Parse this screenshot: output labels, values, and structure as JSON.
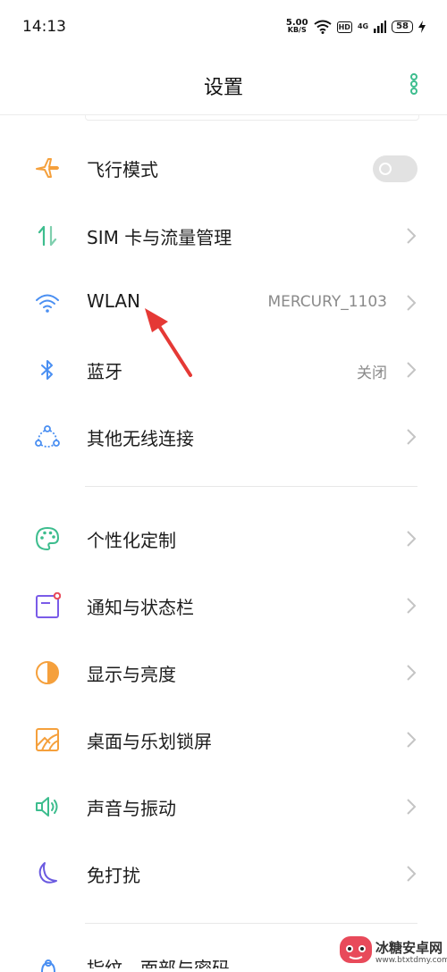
{
  "status_bar": {
    "time": "14:13",
    "net_speed_value": "5.00",
    "net_speed_unit": "KB/S",
    "hd_label": "HD",
    "network_type": "4G",
    "battery": "58"
  },
  "header": {
    "title": "设置"
  },
  "wireless_section": [
    {
      "id": "airplane",
      "label": "飞行模式",
      "toggle_on": false,
      "icon": "airplane-icon",
      "color": "#f5a03c"
    },
    {
      "id": "sim",
      "label": "SIM 卡与流量管理",
      "icon": "sim-data-icon",
      "color": "#3dbd8e"
    },
    {
      "id": "wlan",
      "label": "WLAN",
      "value": "MERCURY_1103",
      "icon": "wifi-icon",
      "color": "#4a8ff2"
    },
    {
      "id": "bluetooth",
      "label": "蓝牙",
      "value": "关闭",
      "icon": "bluetooth-icon",
      "color": "#4a8ff2"
    },
    {
      "id": "other",
      "label": "其他无线连接",
      "icon": "wireless-connections-icon",
      "color": "#4a8ff2"
    }
  ],
  "personal_section": [
    {
      "id": "personalize",
      "label": "个性化定制",
      "icon": "palette-icon",
      "color": "#3dbd8e"
    },
    {
      "id": "notify",
      "label": "通知与状态栏",
      "icon": "notification-icon",
      "color": "#7a5be8"
    },
    {
      "id": "display",
      "label": "显示与亮度",
      "icon": "brightness-icon",
      "color": "#f5a03c"
    },
    {
      "id": "desktop",
      "label": "桌面与乐划锁屏",
      "icon": "wallpaper-icon",
      "color": "#f5a03c"
    },
    {
      "id": "sound",
      "label": "声音与振动",
      "icon": "speaker-icon",
      "color": "#3dbd8e"
    },
    {
      "id": "dnd",
      "label": "免打扰",
      "icon": "moon-icon",
      "color": "#6a5ae0"
    }
  ],
  "partial_row_label": "指纹、面部与密码",
  "watermark": {
    "name": "冰糖安卓网",
    "url": "www.btxtdmy.com"
  },
  "colors": {
    "accent": "#3dbd8e",
    "arrow": "#e53935",
    "chevron": "#c4c4c4"
  }
}
